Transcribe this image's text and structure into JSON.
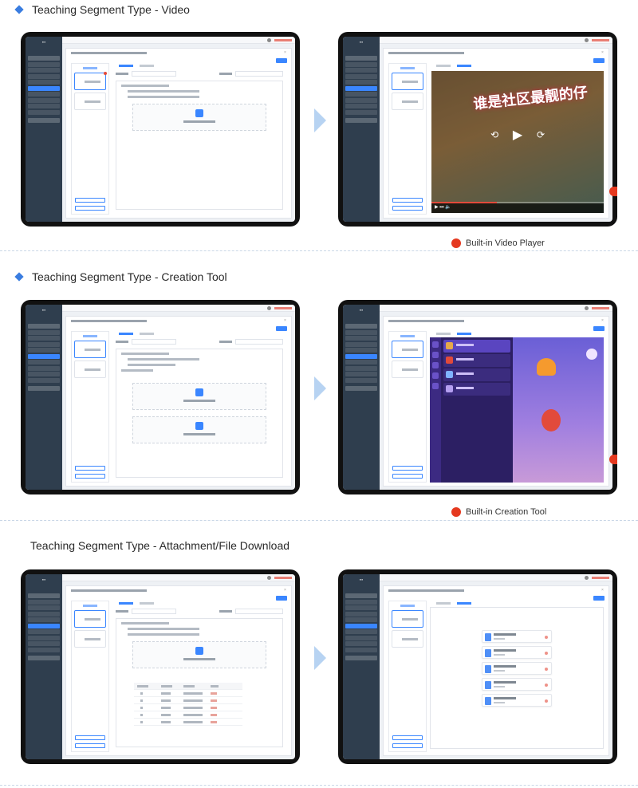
{
  "sections": [
    {
      "title": "Teaching Segment Type - Video",
      "has_marker": true,
      "legend": "Built-in Video Player"
    },
    {
      "title": "Teaching Segment Type - Creation Tool",
      "has_marker": true,
      "legend": "Built-in Creation Tool"
    },
    {
      "title": "Teaching Segment Type - Attachment/File Download",
      "has_marker": false,
      "legend": ""
    }
  ],
  "video_overlay_text": "谁是社区最靓的仔",
  "colors": {
    "accent": "#3a86ff",
    "marker": "#3a7de0",
    "legend_dot": "#e5391f",
    "arrow": "#b7d3f2",
    "sidebar": "#2f3e4e",
    "tablet_frame": "#111111"
  },
  "icons": {
    "section_marker": "diamond-icon",
    "legend": "pin-icon",
    "flow": "arrow-right-icon",
    "play": "play-icon"
  }
}
